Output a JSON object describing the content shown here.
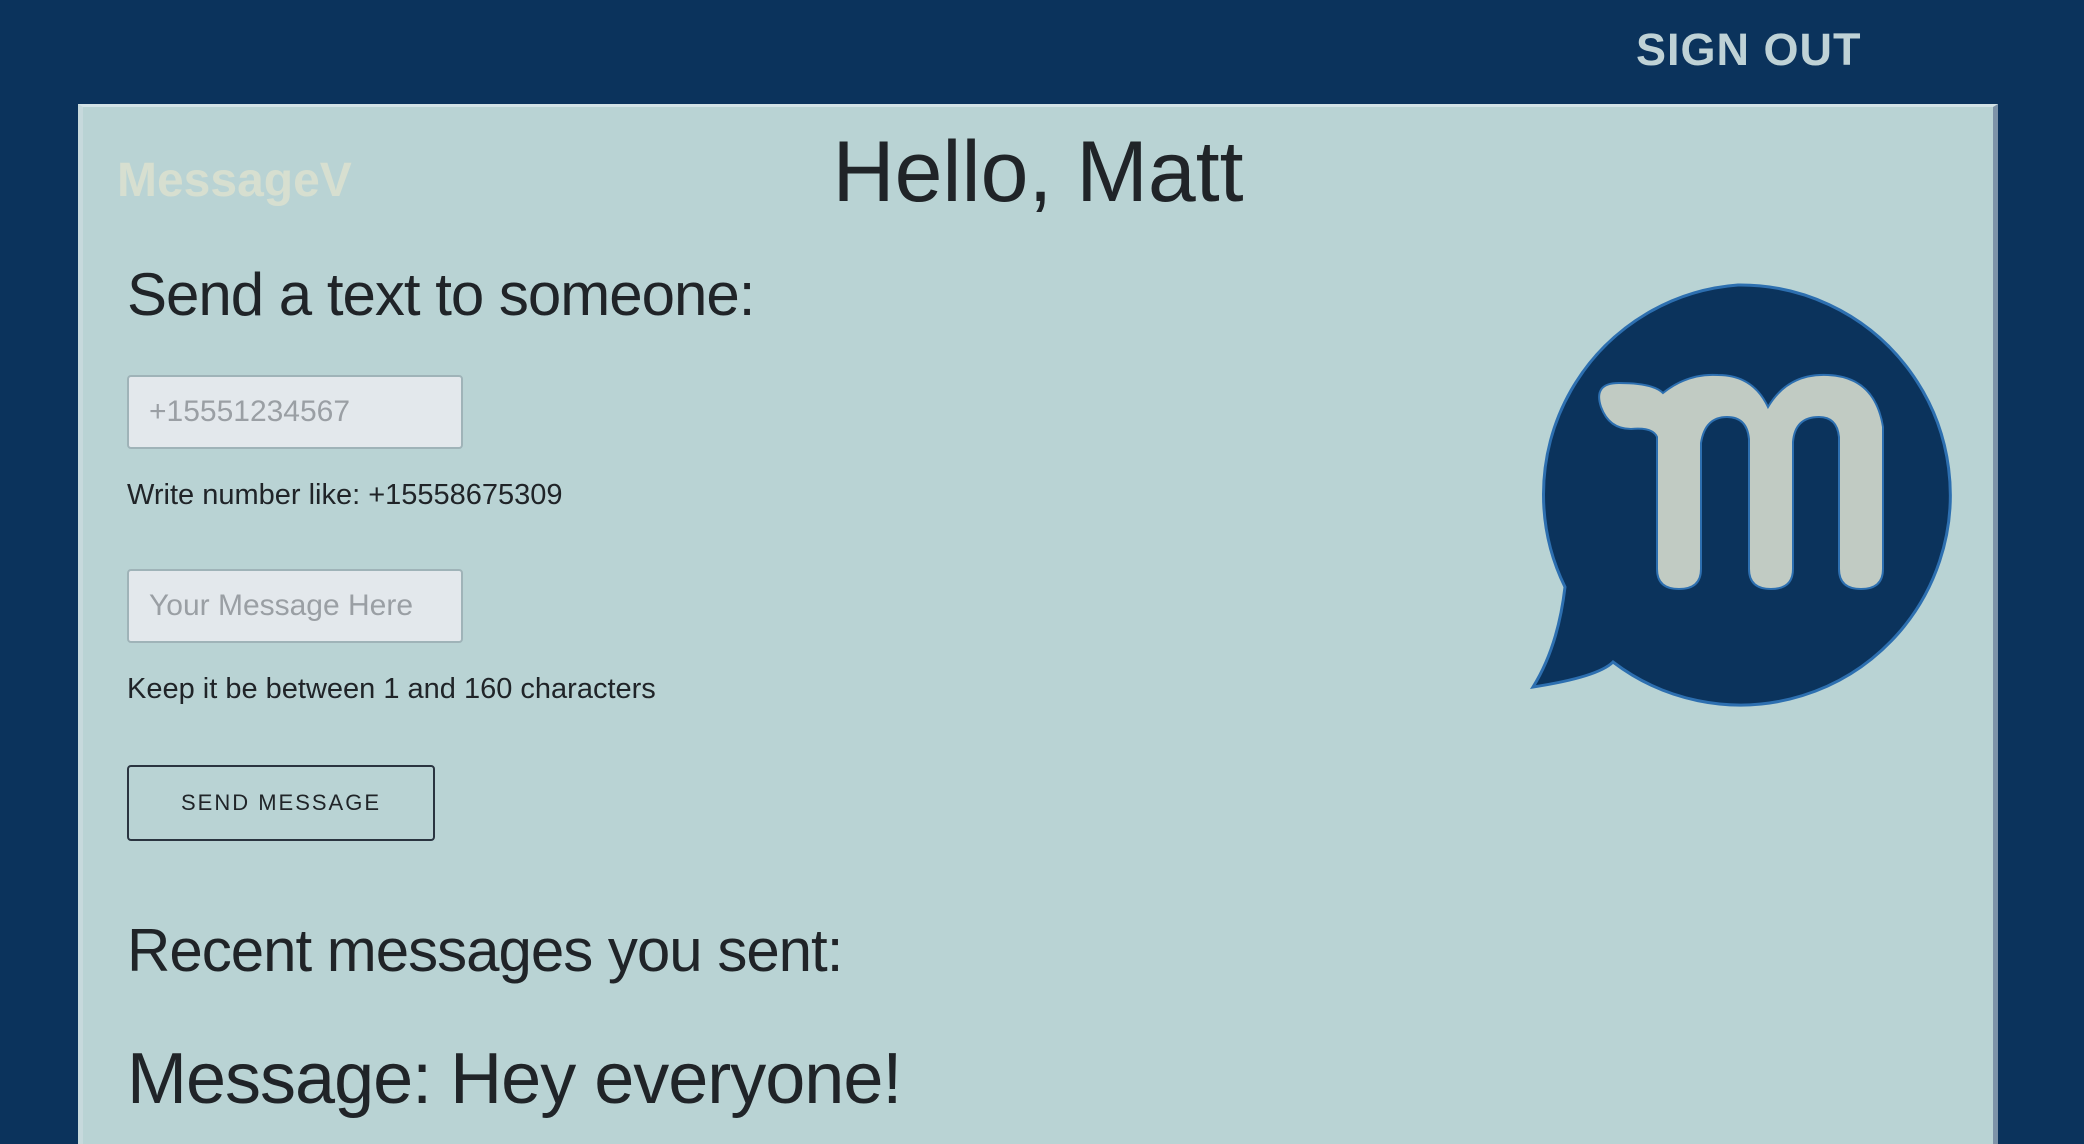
{
  "header": {
    "sign_out_label": "SIGN OUT"
  },
  "app": {
    "brand": "MessageV",
    "greeting": "Hello, Matt"
  },
  "compose": {
    "title": "Send a text to someone:",
    "phone_placeholder": "+15551234567",
    "phone_hint": "Write number like: +15558675309",
    "message_placeholder": "Your Message Here",
    "message_hint": "Keep it be between 1 and 160 characters",
    "send_label": "SEND MESSAGE"
  },
  "recent": {
    "title": "Recent messages you sent:",
    "messages": [
      {
        "text": "Message: Hey everyone!"
      }
    ]
  },
  "logo": {
    "icon": "message-bubble-m-logo",
    "bubble_color": "#0b335c",
    "letter_color": "#c1cbc3"
  },
  "colors": {
    "background": "#0b335c",
    "panel": "#b9d3d4",
    "brand_text": "#d7dfd0",
    "signout_text": "#bfd2d6"
  }
}
